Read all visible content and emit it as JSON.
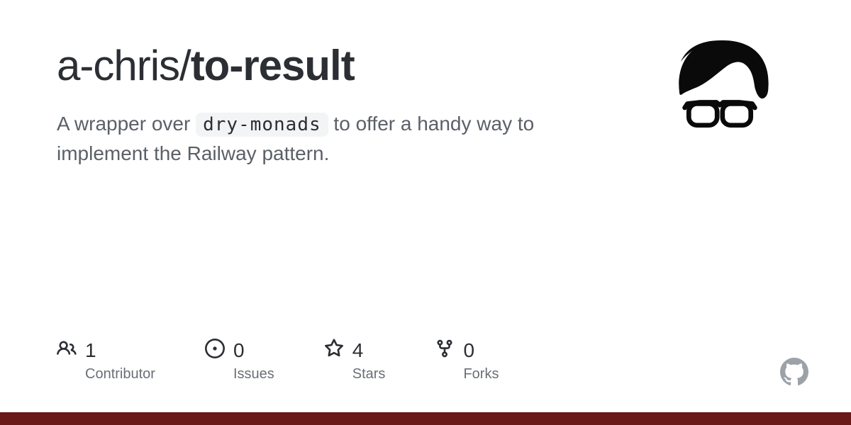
{
  "repo": {
    "owner": "a-chris",
    "name": "to-result",
    "description_before": "A wrapper over ",
    "description_code": "dry-monads",
    "description_after": " to offer a handy way to implement the Railway pattern."
  },
  "stats": {
    "contributors": {
      "value": "1",
      "label": "Contributor"
    },
    "issues": {
      "value": "0",
      "label": "Issues"
    },
    "stars": {
      "value": "4",
      "label": "Stars"
    },
    "forks": {
      "value": "0",
      "label": "Forks"
    }
  },
  "colors": {
    "accent_bar": "#6a1818"
  }
}
